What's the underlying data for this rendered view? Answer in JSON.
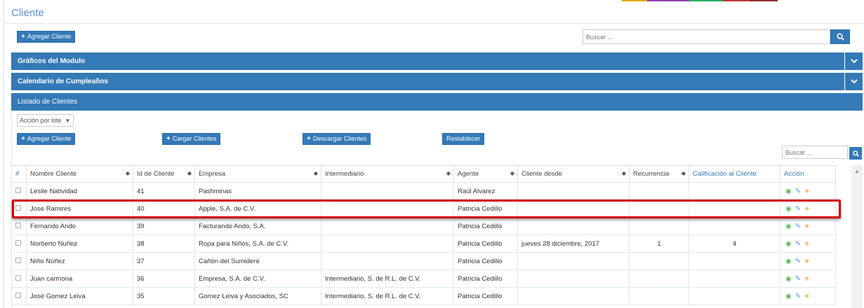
{
  "page": {
    "title": "Cliente"
  },
  "toolbar": {
    "add_client_label": "Agregar Cliente",
    "search_placeholder": "Buscar ..."
  },
  "panels": {
    "graficos": "Gráficos del Modulo",
    "calendario": "Calendario de Cumpleaños",
    "listado": "Listado de Clientes"
  },
  "listado": {
    "lote_select": "Acción por lote",
    "buttons": {
      "agregar": "Agregar Cliente",
      "cargar": "Cargar Clientes",
      "descargar": "Descargar Clientes",
      "restablecer": "Restablecer"
    },
    "search_placeholder": "Buscar ..."
  },
  "table": {
    "headers": {
      "hash": "#",
      "nombre": "Nombre Cliente",
      "id": "Id de Cliente",
      "empresa": "Empresa",
      "intermediario": "Intermediario",
      "agente": "Agente",
      "desde": "Cliente desde",
      "recurrencia": "Recurrencia",
      "calificacion": "Calificación al Cliente",
      "accion": "Acción"
    },
    "rows": [
      {
        "nombre": "Leslie Natividad",
        "id": "41",
        "empresa": "Pashminas",
        "intermediario": "",
        "agente": "Raúl Alvarez",
        "desde": "",
        "recurrencia": "",
        "calificacion": ""
      },
      {
        "nombre": "Jose Ramires",
        "id": "40",
        "empresa": "Apple, S.A. de C.V.",
        "intermediario": "",
        "agente": "Patricia Cedillo",
        "desde": "",
        "recurrencia": "",
        "calificacion": ""
      },
      {
        "nombre": "Fernando Ando",
        "id": "39",
        "empresa": "Facturando Ando, S.A.",
        "intermediario": "",
        "agente": "Patricia Cedillo",
        "desde": "",
        "recurrencia": "",
        "calificacion": ""
      },
      {
        "nombre": "Norberto Nuñez",
        "id": "38",
        "empresa": "Ropa para Niños, S.A. de C.V.",
        "intermediario": "",
        "agente": "Patricia Cedillo",
        "desde": "jueves 28 diciembre, 2017",
        "recurrencia": "1",
        "calificacion": "4"
      },
      {
        "nombre": "Niño Núñez",
        "id": "37",
        "empresa": "Cañón del Sumidero",
        "intermediario": "",
        "agente": "Patricia Cedillo",
        "desde": "",
        "recurrencia": "",
        "calificacion": ""
      },
      {
        "nombre": "Juan carmona",
        "id": "36",
        "empresa": "Empresa, S.A. de C.V.",
        "intermediario": "Intermediario, S. de R.L. de C.V.",
        "agente": "Patricia Cedillo",
        "desde": "",
        "recurrencia": "",
        "calificacion": ""
      },
      {
        "nombre": "José Gomez Leiva",
        "id": "35",
        "empresa": "Gomez Leiva y Asociados, SC",
        "intermediario": "Intermediario, S. de R.L. de C.V.",
        "agente": "Patricia Cedillo",
        "desde": "",
        "recurrencia": "",
        "calificacion": ""
      }
    ]
  },
  "colors": {
    "primary": "#337ab7",
    "highlight": "#d40000",
    "action_view": "#5cb85c",
    "action_edit": "#5b9bd5",
    "action_add": "#f0ad4e",
    "top_strip": [
      "#e0a800",
      "#8e44ad",
      "#27ae60",
      "#c0392b",
      "#c0392b"
    ]
  },
  "icons": {
    "search": "search-icon",
    "chevron": "chevron-down-icon",
    "sort": "sort-icon",
    "view": "eye-icon",
    "edit": "edit-icon",
    "add": "plus-icon"
  }
}
